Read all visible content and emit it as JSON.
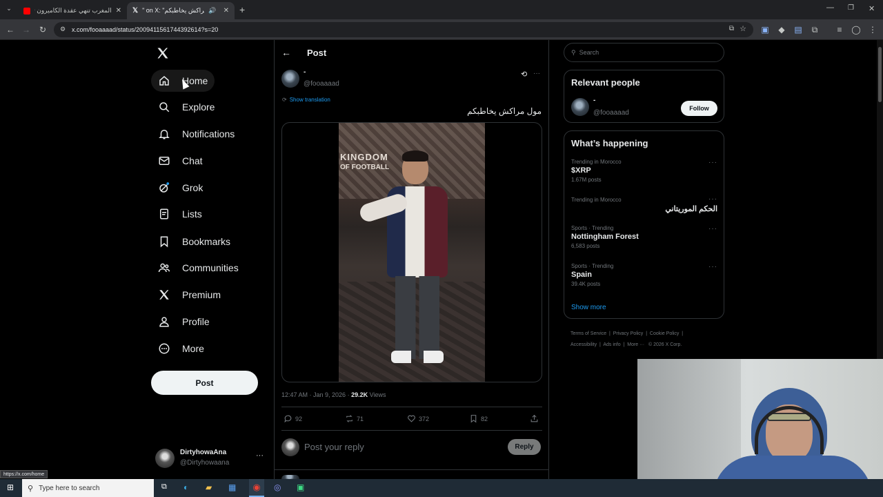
{
  "browser": {
    "tabs": [
      {
        "title": "المغرب تنهي عقدة الكاميرون تتأه",
        "active": false
      },
      {
        "title": "\" on X: \"مول مراكش يخاطبكم",
        "active": true
      }
    ],
    "url": "x.com/fooaaaad/status/2009411561744392614?s=20",
    "status_url": "https://x.com/home"
  },
  "nav": {
    "items": [
      {
        "label": "Home",
        "icon": "home-icon"
      },
      {
        "label": "Explore",
        "icon": "search-icon"
      },
      {
        "label": "Notifications",
        "icon": "bell-icon"
      },
      {
        "label": "Chat",
        "icon": "mail-icon"
      },
      {
        "label": "Grok",
        "icon": "grok-icon"
      },
      {
        "label": "Lists",
        "icon": "list-icon"
      },
      {
        "label": "Bookmarks",
        "icon": "bookmark-icon"
      },
      {
        "label": "Communities",
        "icon": "people-icon"
      },
      {
        "label": "Premium",
        "icon": "x-logo-icon"
      },
      {
        "label": "Profile",
        "icon": "person-icon"
      },
      {
        "label": "More",
        "icon": "more-circle-icon"
      }
    ],
    "post_label": "Post",
    "account": {
      "name": "DirtyhowaAna",
      "handle": "@Dirtyhowaana"
    }
  },
  "post": {
    "header": "Post",
    "author_name": "-",
    "author_handle": "@fooaaaad",
    "show_translation": "Show translation",
    "text": "مول مراكش يخاطبكم",
    "video_text_1": "KINGDOM",
    "video_text_2": "OF FOOTBALL",
    "timestamp": "12:47 AM · Jan 9, 2026 ·",
    "views_count": "29.2K",
    "views_label": "Views",
    "replies": "92",
    "reposts": "71",
    "likes": "372",
    "bookmarks": "82",
    "reply_placeholder": "Post your reply",
    "reply_button": "Reply"
  },
  "sidebar": {
    "search_placeholder": "Search",
    "relevant_title": "Relevant people",
    "relevant_person": {
      "name": "-",
      "handle": "@fooaaaad",
      "follow": "Follow"
    },
    "happening_title": "What’s happening",
    "trends": [
      {
        "meta": "Trending in Morocco",
        "title": "$XRP",
        "count": "1.67M posts"
      },
      {
        "meta": "Trending in Morocco",
        "title": "الحكم الموريتاني",
        "count": ""
      },
      {
        "meta": "Sports · Trending",
        "title": "Nottingham Forest",
        "count": "6,583 posts"
      },
      {
        "meta": "Sports · Trending",
        "title": "Spain",
        "count": "39.4K posts"
      }
    ],
    "show_more": "Show more",
    "footer": [
      "Terms of Service",
      "Privacy Policy",
      "Cookie Policy",
      "Accessibility",
      "Ads info",
      "More ···",
      "© 2026 X Corp."
    ]
  },
  "taskbar": {
    "search_placeholder": "Type here to search"
  },
  "colors": {
    "accent": "#1d9bf0",
    "background": "#000000",
    "border": "#2f3336"
  }
}
